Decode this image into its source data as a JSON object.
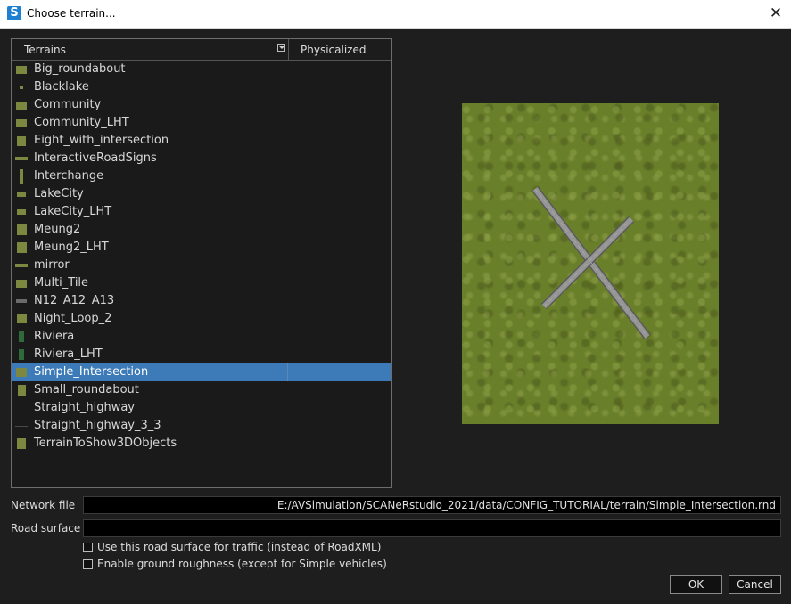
{
  "window": {
    "title": "Choose terrain...",
    "app_icon_letter": "S",
    "close_glyph": "✕"
  },
  "terrain_list": {
    "columns": {
      "terrains": "Terrains",
      "physicalized": "Physicalized"
    },
    "selected": "Simple_Intersection",
    "items": [
      "Big_roundabout",
      "Blacklake",
      "Community",
      "Community_LHT",
      "Eight_with_intersection",
      "InteractiveRoadSigns",
      "Interchange",
      "LakeCity",
      "LakeCity_LHT",
      "Meung2",
      "Meung2_LHT",
      "mirror",
      "Multi_Tile",
      "N12_A12_A13",
      "Night_Loop_2",
      "Riviera",
      "Riviera_LHT",
      "Simple_Intersection",
      "Small_roundabout",
      "Straight_highway",
      "Straight_highway_3_3",
      "TerrainToShow3DObjects"
    ]
  },
  "network_file": {
    "label": "Network file",
    "value": "E:/AVSimulation/SCANeRstudio_2021/data/CONFIG_TUTORIAL/terrain/Simple_Intersection.rnd"
  },
  "road_surface": {
    "label": "Road surface",
    "value": ""
  },
  "options": {
    "use_for_traffic": {
      "label": "Use this road surface for traffic (instead of RoadXML)",
      "checked": false
    },
    "ground_roughness": {
      "label": "Enable ground roughness (except for Simple vehicles)",
      "checked": false
    }
  },
  "buttons": {
    "ok": "OK",
    "cancel": "Cancel"
  },
  "colors": {
    "selection": "#3d7ab8",
    "grass": "#6a7f2a",
    "road": "#8c8c8c"
  }
}
